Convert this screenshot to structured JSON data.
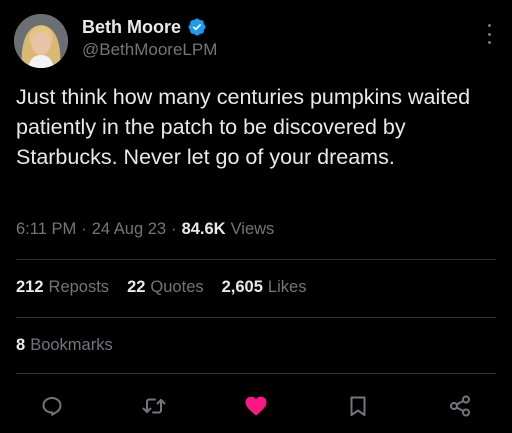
{
  "author": {
    "name": "Beth Moore",
    "handle": "@BethMooreLPM",
    "verified": true
  },
  "tweet": {
    "text": "Just think how many centuries pumpkins waited patiently in the patch to be discovered by Starbucks. Never let go of your dreams.",
    "time": "6:11 PM",
    "separator": "·",
    "date": "24 Aug 23",
    "views_count": "84.6K",
    "views_label": "Views"
  },
  "stats": {
    "reposts_count": "212",
    "reposts_label": "Reposts",
    "quotes_count": "22",
    "quotes_label": "Quotes",
    "likes_count": "2,605",
    "likes_label": "Likes",
    "bookmarks_count": "8",
    "bookmarks_label": "Bookmarks"
  },
  "actions": [
    {
      "name": "reply",
      "icon": "comment-icon"
    },
    {
      "name": "repost",
      "icon": "repost-icon"
    },
    {
      "name": "like",
      "icon": "heart-icon",
      "active": true
    },
    {
      "name": "bookmark",
      "icon": "bookmark-icon"
    },
    {
      "name": "share",
      "icon": "share-icon"
    }
  ],
  "colors": {
    "background": "#000000",
    "text": "#e7e9ea",
    "secondary": "#71767b",
    "verified": "#1d9bf0",
    "like": "#f91880",
    "divider": "#2f3336"
  }
}
